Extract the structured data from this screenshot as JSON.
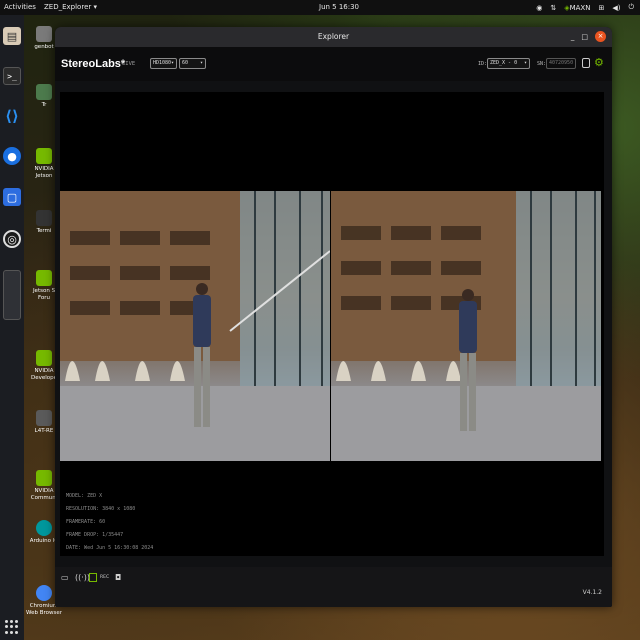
{
  "topbar": {
    "activities": "Activities",
    "app_menu": "ZED_Explorer ▾",
    "clock": "Jun 5  16:30",
    "status_maxn": "MAXN"
  },
  "desktop_icons": {
    "genbot": "genbot",
    "tr": "Tr",
    "nvidia_jetson": "NVIDIA Jetson",
    "terminal": "Termi",
    "jetson_forum": "Jetson S Foru",
    "developer": "NVIDIA Develope",
    "l4t": "L4T-RE",
    "community": "NVIDIA Communi",
    "arduino": "Arduino IC",
    "chromium": "Chromium Web Browser"
  },
  "window": {
    "title": "Explorer",
    "minimize": "_",
    "maximize": "□",
    "close": "×"
  },
  "header": {
    "logo": "StereoLabs*",
    "live": "LIVE",
    "resolution": "HD1080",
    "fps": "60",
    "id_label": "ID:",
    "id_value": "ZED_X  - 0",
    "sn_label": "SN:",
    "sn_value": "40720950"
  },
  "overlay": {
    "model": "MODEL: ZED X",
    "resolution": "RESOLUTION: 3840 x 1080",
    "framerate": "FRAMERATE: 60",
    "frame_drop": "FRAME DROP: 1/35447",
    "date": "DATE: Wed Jun 5 16:30:08 2024"
  },
  "bottombar": {
    "rec_label": "REC",
    "version": "V4.1.2"
  },
  "colors": {
    "accent": "#76b900",
    "close_button": "#e95420"
  }
}
